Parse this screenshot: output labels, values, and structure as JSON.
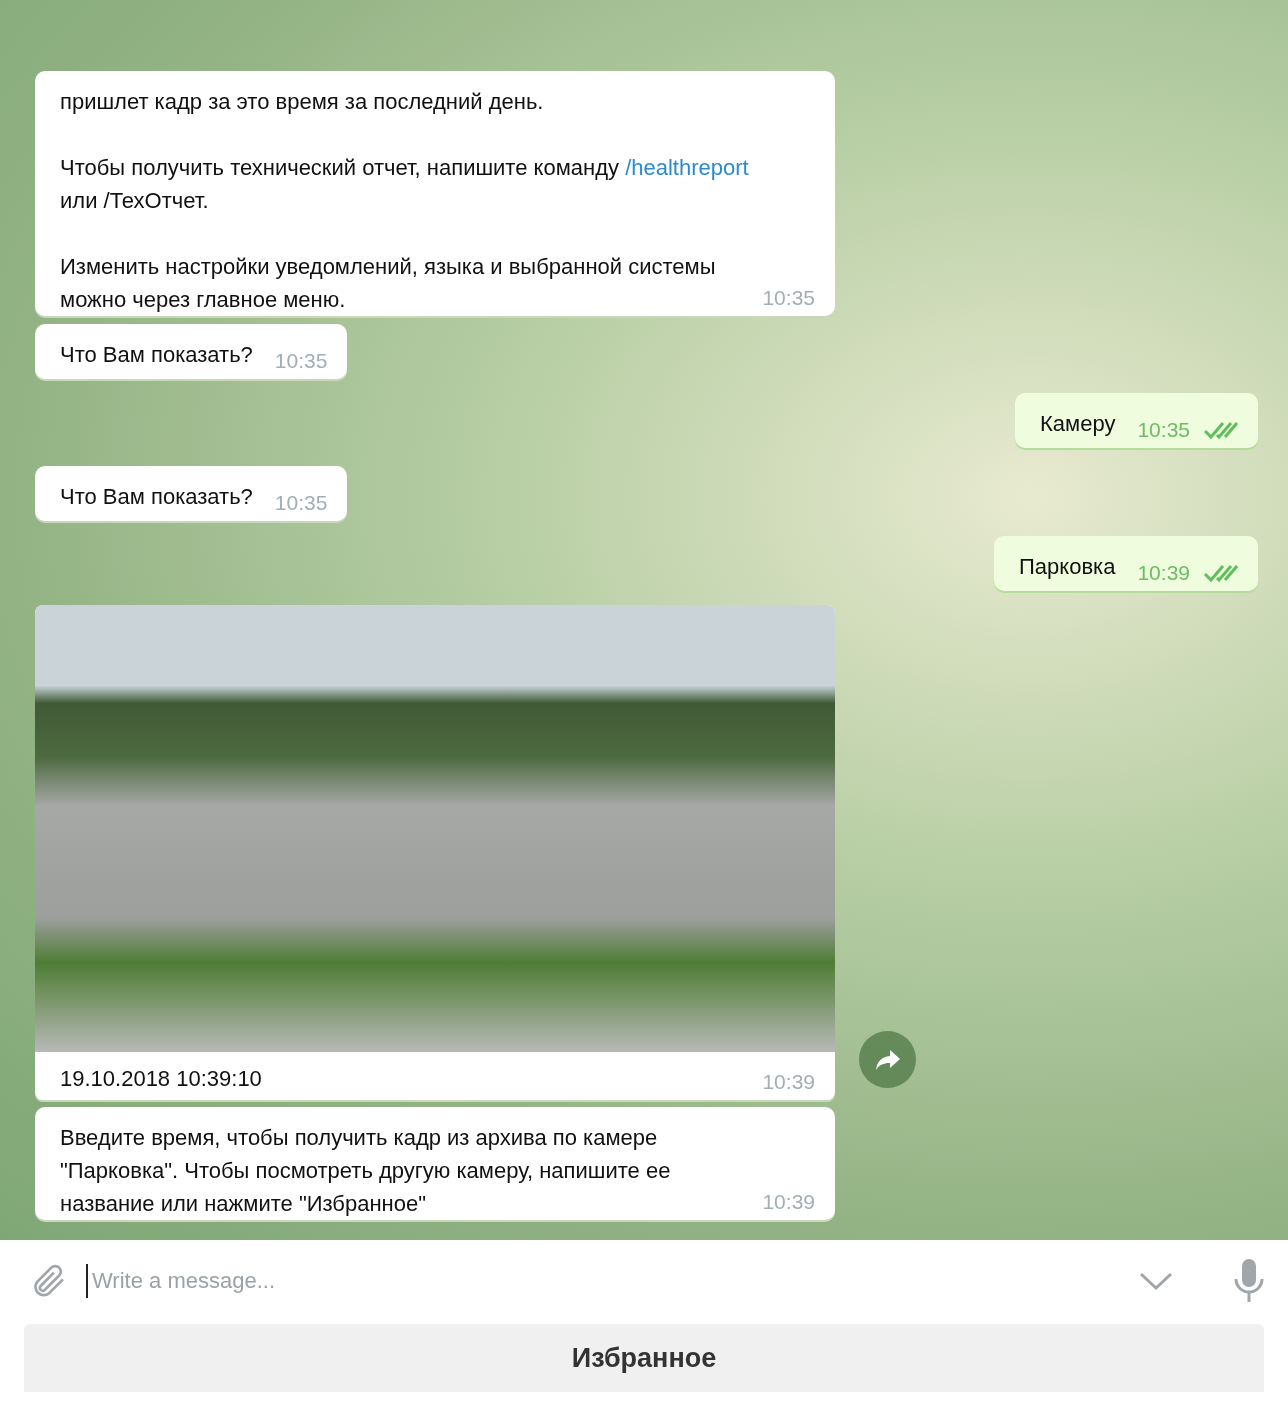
{
  "messages": [
    {
      "kind": "text",
      "outgoing": false,
      "paragraphs": [
        [
          {
            "text": "пришлет кадр за это время за последний день."
          }
        ],
        [
          {
            "text": "Чтобы получить технический отчет, напишите команду "
          },
          {
            "text": "/healthreport",
            "link": true
          },
          {
            "text": " или /ТехОтчет."
          }
        ],
        [
          {
            "text": "Изменить настройки уведомлений, языка и выбранной системы можно через главное меню."
          }
        ]
      ],
      "time": "10:35"
    },
    {
      "kind": "text",
      "outgoing": false,
      "paragraphs": [
        [
          {
            "text": "Что Вам показать?"
          }
        ]
      ],
      "time": "10:35"
    },
    {
      "kind": "text",
      "outgoing": true,
      "paragraphs": [
        [
          {
            "text": "Камеру"
          }
        ]
      ],
      "time": "10:35",
      "read": true
    },
    {
      "kind": "text",
      "outgoing": false,
      "paragraphs": [
        [
          {
            "text": "Что Вам показать?"
          }
        ]
      ],
      "time": "10:35"
    },
    {
      "kind": "text",
      "outgoing": true,
      "paragraphs": [
        [
          {
            "text": "Парковка"
          }
        ]
      ],
      "time": "10:39",
      "read": true
    },
    {
      "kind": "photo",
      "outgoing": false,
      "caption": "19.10.2018 10:39:10",
      "time": "10:39",
      "forward": true
    },
    {
      "kind": "text",
      "outgoing": false,
      "paragraphs": [
        [
          {
            "text": "Введите время, чтобы получить кадр из архива по камере \"Парковка\". Чтобы посмотреть другую камеру, напишите ее название или нажмите \"Избранное\""
          }
        ]
      ],
      "time": "10:39"
    }
  ],
  "composer": {
    "placeholder": "Write a message..."
  },
  "keyboard": {
    "buttons": [
      "Избранное"
    ]
  }
}
